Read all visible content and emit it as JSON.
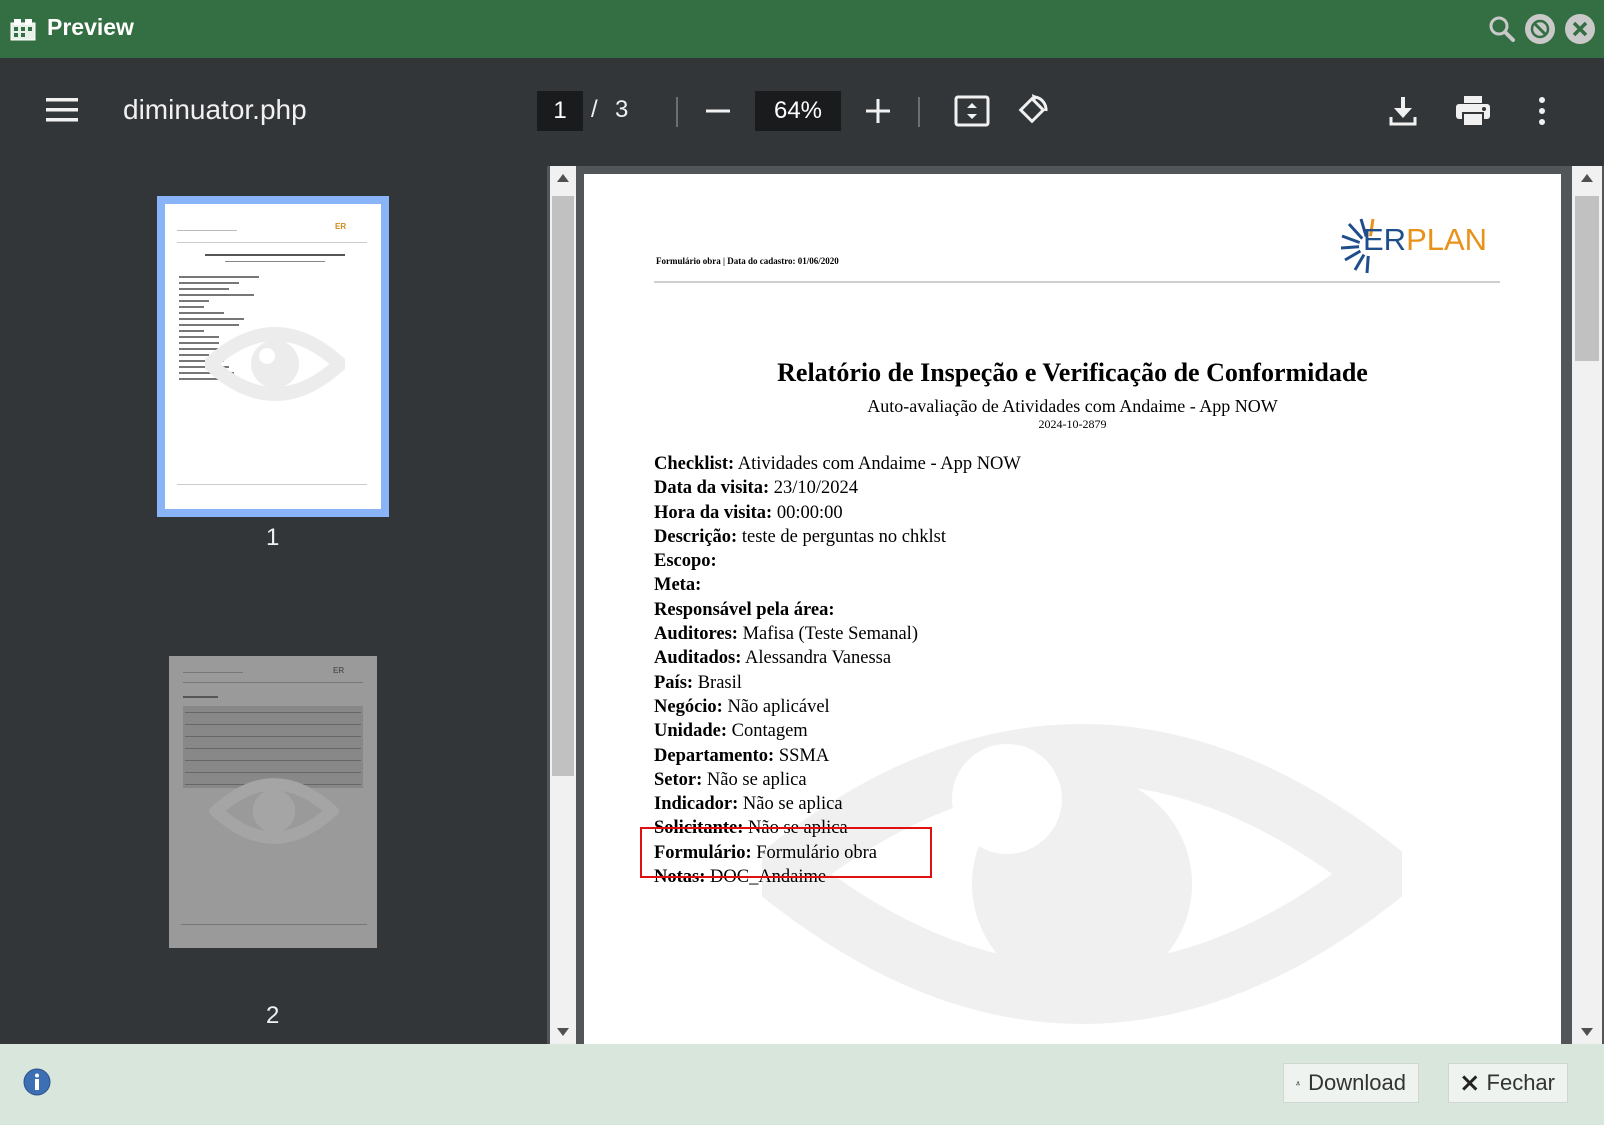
{
  "window": {
    "title": "Preview"
  },
  "toolbar": {
    "filename": "diminuator.php",
    "current_page": "1",
    "page_separator": "/",
    "total_pages": "3",
    "zoom": "64%"
  },
  "sidebar": {
    "thumbnails": [
      {
        "label": "1"
      },
      {
        "label": "2"
      }
    ]
  },
  "document": {
    "header": "Formulário obra | Data do cadastro: 01/06/2020",
    "logo": "ERPLAN",
    "title": "Relatório de Inspeção e Verificação de Conformidade",
    "subtitle": "Auto-avaliação de Atividades com Andaime - App NOW",
    "code": "2024-10-2879",
    "fields": [
      {
        "label": "Checklist:",
        "value": "Atividades com Andaime - App NOW"
      },
      {
        "label": "Data da visita:",
        "value": "23/10/2024"
      },
      {
        "label": "Hora da visita:",
        "value": "00:00:00"
      },
      {
        "label": "Descrição:",
        "value": "teste de perguntas no chklst"
      },
      {
        "label": "Escopo:",
        "value": ""
      },
      {
        "label": "Meta:",
        "value": ""
      },
      {
        "label": "Responsável pela área:",
        "value": ""
      },
      {
        "label": "Auditores:",
        "value": "Mafisa (Teste Semanal)"
      },
      {
        "label": "Auditados:",
        "value": "Alessandra Vanessa"
      },
      {
        "label": "País:",
        "value": "Brasil"
      },
      {
        "label": "Negócio:",
        "value": "Não aplicável"
      },
      {
        "label": "Unidade:",
        "value": "Contagem"
      },
      {
        "label": "Departamento:",
        "value": "SSMA"
      },
      {
        "label": "Setor:",
        "value": "Não se aplica"
      },
      {
        "label": "Indicador:",
        "value": "Não se aplica"
      },
      {
        "label": "Solicitante:",
        "value": "Não se aplica"
      },
      {
        "label": "Formulário:",
        "value": "Formulário obra"
      },
      {
        "label": "Notas:",
        "value": "DOC_Andaime"
      }
    ]
  },
  "footer": {
    "download_label": "Download",
    "close_label": "Fechar"
  },
  "colors": {
    "titlebar": "#336f42",
    "toolbar": "#323639",
    "viewer_bg": "#525659",
    "bottombar": "#d9e6dc",
    "highlight": "#e01010",
    "selected_thumb": "#8ab4f8"
  }
}
